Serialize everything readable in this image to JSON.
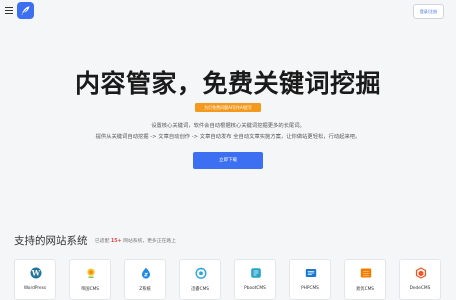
{
  "header": {
    "login_label": "登录/注册"
  },
  "hero": {
    "title": "内容管家，免费关键词挖掘",
    "badge": "为打免费问题AI写作AI提写",
    "desc_line1": "设置核心关键词，软件会自动根据核心关键词挖掘更多的长尾词。",
    "desc_line2": "提供从关键词自动挖掘 -> 文章自动创作 -> 文章自动发布 全自动文章实施方案，让你做站更轻松，行动起来吧。",
    "cta_label": "立即下载"
  },
  "systems": {
    "title": "支持的网站系统",
    "note_prefix": "已适配 ",
    "note_count": "15+",
    "note_suffix": " 网站系统，更多正在路上",
    "items": [
      {
        "label": "WordPress",
        "icon": "wordpress-icon"
      },
      {
        "label": "帝国CMS",
        "icon": "empire-cms-icon"
      },
      {
        "label": "Z系统",
        "icon": "z-system-icon"
      },
      {
        "label": "迅睿CMS",
        "icon": "xunrui-cms-icon"
      },
      {
        "label": "PbootCMS",
        "icon": "pbootcms-icon"
      },
      {
        "label": "PHPCMS",
        "icon": "phpcms-icon"
      },
      {
        "label": "易优CMS",
        "icon": "eyoucms-icon"
      },
      {
        "label": "DedeCMS",
        "icon": "dedecms-icon"
      }
    ]
  },
  "colors": {
    "accent": "#3d6ff2",
    "badge": "#f39a1e",
    "highlight": "#e5484d"
  }
}
